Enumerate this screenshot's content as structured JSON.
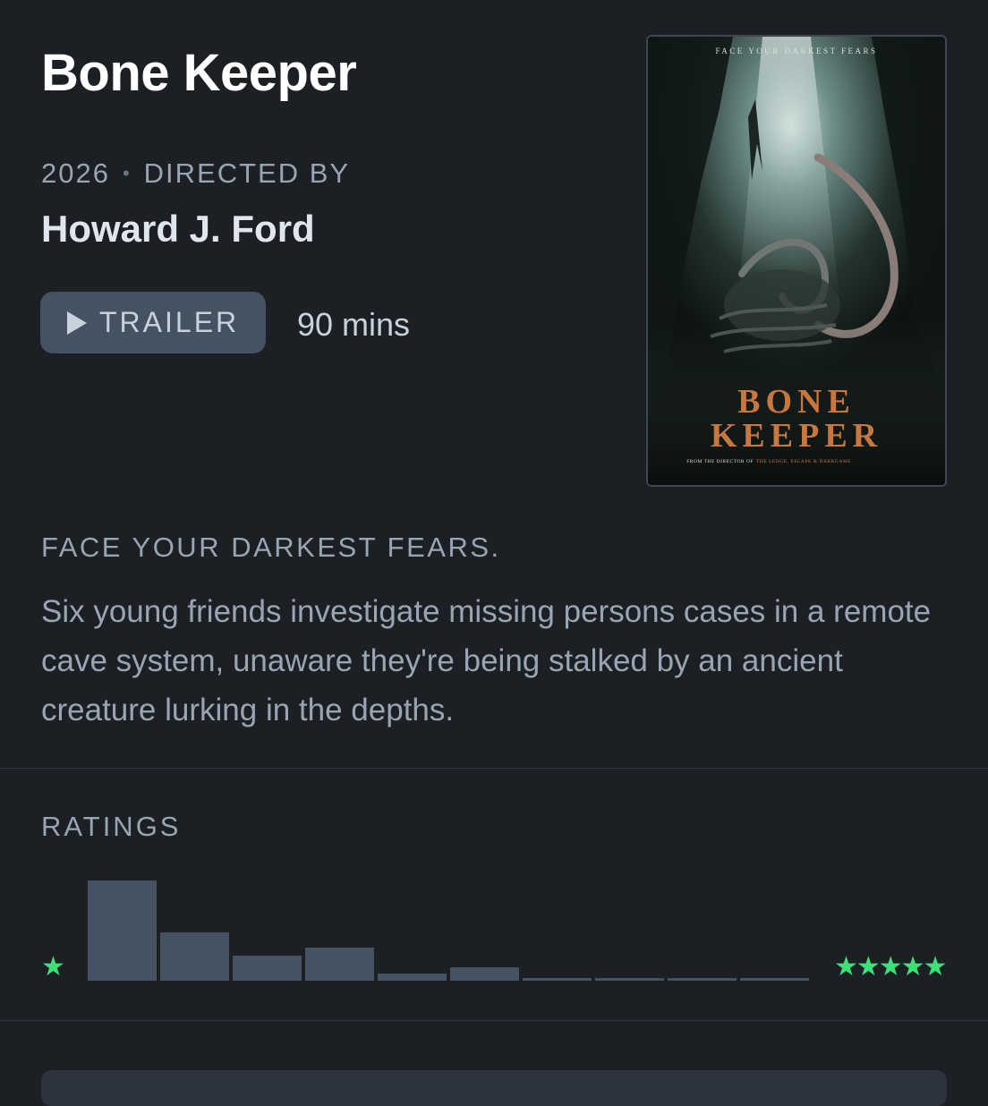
{
  "film": {
    "title": "Bone Keeper",
    "year": "2026",
    "directed_by_label": "DIRECTED BY",
    "director": "Howard J. Ford",
    "trailer_label": "TRAILER",
    "runtime": "90 mins",
    "tagline": "FACE YOUR DARKEST FEARS.",
    "synopsis": "Six young friends investigate missing persons cases in a remote cave system, unaware they're being stalked by an ancient creature lurking in the depths."
  },
  "poster": {
    "tagline": "FACE YOUR DARKEST FEARS",
    "title_line1": "BONE",
    "title_line2": "KEEPER",
    "credit_prefix": "FROM THE DIRECTOR OF",
    "credit_films": "THE LEDGE, ESCAPE & DARKGAME"
  },
  "ratings": {
    "label": "RATINGS",
    "low_star": "★",
    "high_stars": "★★★★★",
    "star_color": "#3ee07a",
    "bar_color": "#455261",
    "distribution": [
      1.0,
      0.48,
      0.25,
      0.33,
      0.07,
      0.13,
      0.01,
      0.01,
      0.01,
      0.01
    ]
  }
}
